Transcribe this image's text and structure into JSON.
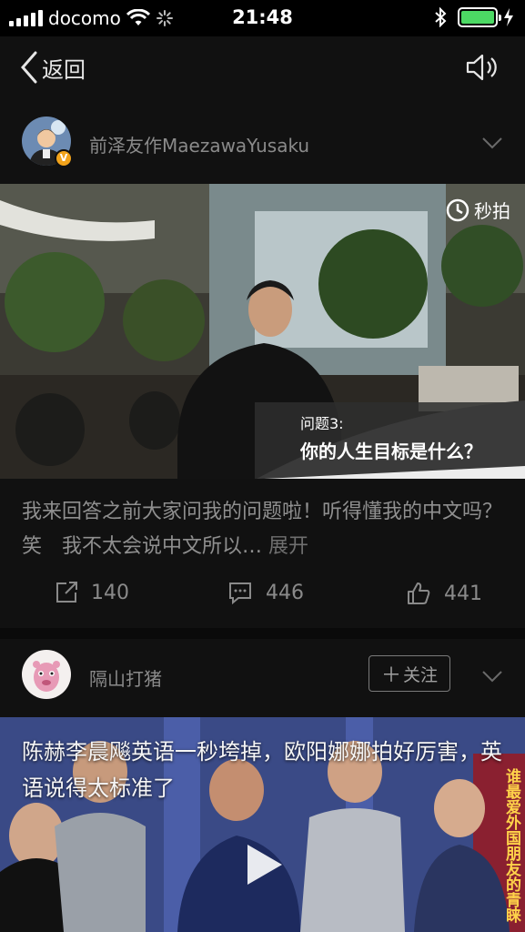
{
  "status_bar": {
    "carrier": "docomo",
    "time": "21:48"
  },
  "nav": {
    "back_label": "返回"
  },
  "posts": [
    {
      "username": "前泽友作MaezawaYusaku",
      "video_watermark": "秒拍",
      "video_caption_label": "问题3:",
      "video_caption_text": "你的人生目标是什么？",
      "text": "我来回答之前大家问我的问题啦！听得懂我的中文吗？笑　我不太会说中文所以…",
      "expand_label": "展开",
      "reposts": "140",
      "comments": "446",
      "likes": "441"
    },
    {
      "username": "隔山打猪",
      "follow_label": "关注",
      "video_overlay_text": "陈赫李晨飚英语一秒垮掉，欧阳娜娜拍好厉害，英语说得太标准了",
      "video_side_text": "谁最爱外国朋友的青睐"
    }
  ],
  "colors": {
    "background": "#111111",
    "battery": "#4cd964",
    "verified_badge": "#f2a31b"
  }
}
